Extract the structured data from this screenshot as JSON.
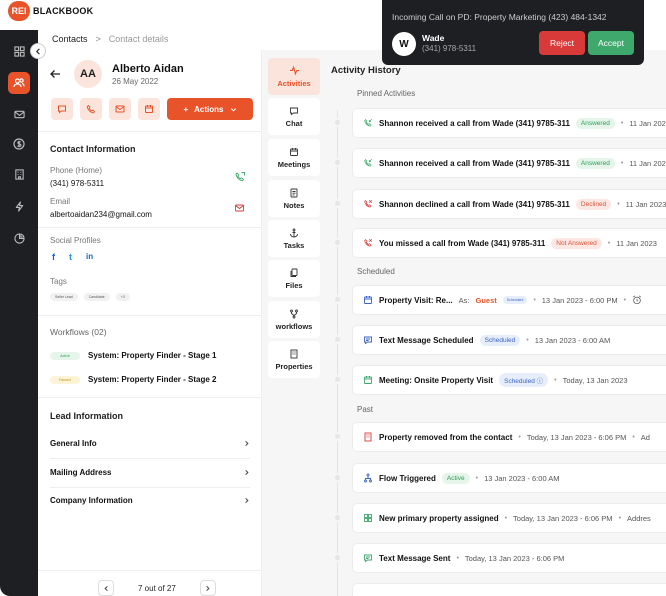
{
  "brand": {
    "mark": "REI",
    "word": "BLACKBOOK",
    "accent": "#e8532a"
  },
  "breadcrumb": {
    "root": "Contacts",
    "sep": ">",
    "current": "Contact details"
  },
  "contact": {
    "initials": "AA",
    "name": "Alberto Aidan",
    "date": "26 May 2022",
    "actions_label": "Actions"
  },
  "contact_info": {
    "title": "Contact Information",
    "phone_label": "Phone (Home)",
    "phone": "(341) 978-5311",
    "email_label": "Email",
    "email": "albertoaidan234@gmail.com"
  },
  "social": {
    "title": "Social Profiles",
    "icons": [
      "f",
      "t",
      "in"
    ]
  },
  "tags": {
    "title": "Tags",
    "items": [
      "Seller Lead",
      "Candidate",
      "+3"
    ]
  },
  "workflows": {
    "title": "Workflows (02)",
    "items": [
      {
        "badge": "Active",
        "name": "System: Property Finder - Stage 1"
      },
      {
        "badge": "Paused",
        "name": "System: Property Finder - Stage 2"
      }
    ]
  },
  "lead": {
    "title": "Lead Information",
    "rows": [
      "General Info",
      "Mailing Address",
      "Company Information"
    ]
  },
  "pager": {
    "text": "7 out of 27"
  },
  "tabs": [
    "Activities",
    "Chat",
    "Meetings",
    "Notes",
    "Tasks",
    "Files",
    "workflows",
    "Properties"
  ],
  "activity": {
    "title": "Activity History",
    "groups": {
      "pinned": "Pinned Activities",
      "scheduled": "Scheduled",
      "past": "Past"
    },
    "pinned": [
      {
        "text": "Shannon received a call from Wade (341) 9785-311",
        "badge": "Answered",
        "meta": "11 Jan 2023"
      },
      {
        "text": "Shannon received a call from Wade (341) 9785-311",
        "badge": "Answered",
        "meta": "11 Jan 2023"
      },
      {
        "text": "Shannon declined a call from Wade (341) 9785-311",
        "badge": "Declined",
        "meta": "11 Jan 2023"
      },
      {
        "text": "You missed a call from Wade (341) 9785-311",
        "badge": "Not Answered",
        "meta": "11 Jan 2023"
      }
    ],
    "scheduled": [
      {
        "text": "Property Visit: Re...",
        "as": "As:",
        "guest": "Guest",
        "badge": "Scheduled",
        "meta": "13 Jan 2023 - 6:00 PM"
      },
      {
        "text": "Text Message Scheduled",
        "badge": "Scheduled",
        "meta": "13 Jan 2023 - 6:00 AM"
      },
      {
        "text": "Meeting: Onsite Property Visit",
        "badge": "Scheduled",
        "meta": "Today, 13 Jan 2023"
      }
    ],
    "past": [
      {
        "text": "Property removed from the contact",
        "meta": "Today, 13 Jan 2023 - 6:06 PM",
        "extra": "Ad"
      },
      {
        "text": "Flow Triggered",
        "badge": "Active",
        "meta": "13 Jan 2023 - 6:00 AM"
      },
      {
        "text": "New primary property assigned",
        "meta": "Today, 13 Jan 2023 - 6:06 PM",
        "extra": "Addres"
      },
      {
        "text": "Text Message Sent",
        "meta": "Today, 13 Jan 2023 - 6:06 PM"
      }
    ]
  },
  "call": {
    "title": "Incoming Call on PD: Property Marketing (423) 484-1342",
    "initial": "W",
    "name": "Wade",
    "phone": "(341) 978-5311",
    "reject": "Reject",
    "accept": "Accept"
  }
}
